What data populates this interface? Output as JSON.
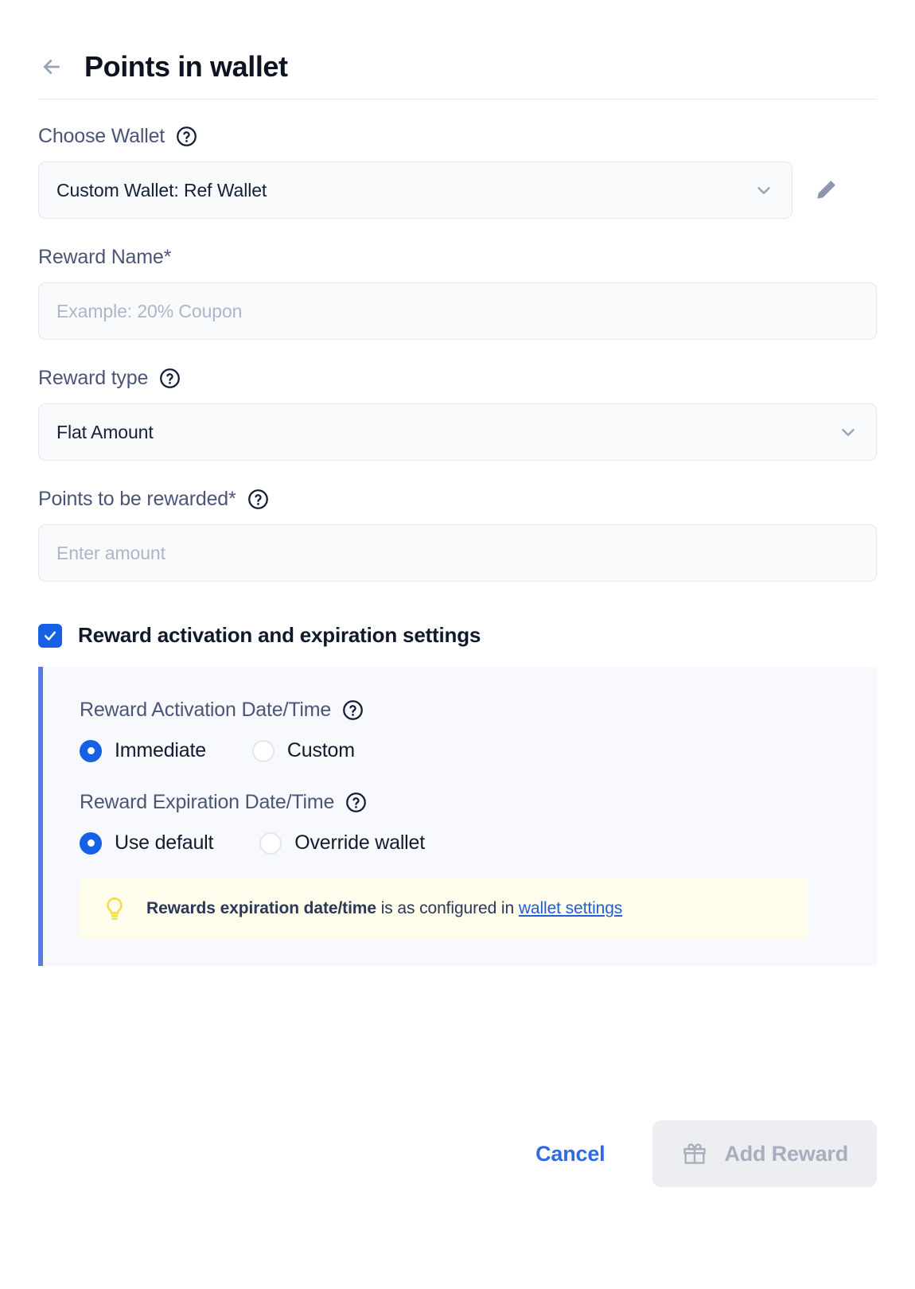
{
  "header": {
    "back_icon": "arrow-left-icon",
    "title": "Points in wallet"
  },
  "form": {
    "wallet": {
      "label": "Choose Wallet",
      "help_icon": "question-mark-icon",
      "selected": "Custom Wallet: Ref Wallet",
      "chevron_icon": "chevron-down-icon",
      "edit_icon": "pencil-icon"
    },
    "reward_name": {
      "label": "Reward Name*",
      "value": "",
      "placeholder": "Example: 20% Coupon"
    },
    "reward_type": {
      "label": "Reward type",
      "help_icon": "question-mark-icon",
      "selected": "Flat Amount",
      "chevron_icon": "chevron-down-icon"
    },
    "points": {
      "label": "Points to be rewarded*",
      "help_icon": "question-mark-icon",
      "value": "",
      "placeholder": "Enter amount"
    },
    "settings_toggle": {
      "label": "Reward activation and expiration settings",
      "checked": true,
      "check_icon": "check-icon"
    },
    "activation": {
      "label": "Reward Activation Date/Time",
      "help_icon": "question-mark-icon",
      "options": [
        {
          "label": "Immediate",
          "selected": true
        },
        {
          "label": "Custom",
          "selected": false
        }
      ]
    },
    "expiration": {
      "label": "Reward Expiration Date/Time",
      "help_icon": "question-mark-icon",
      "options": [
        {
          "label": "Use default",
          "selected": true
        },
        {
          "label": "Override wallet",
          "selected": false
        }
      ]
    },
    "info_banner": {
      "icon": "lightbulb-icon",
      "strong_text": "Rewards expiration date/time",
      "text": " is as configured in ",
      "link_text": "wallet settings"
    }
  },
  "footer": {
    "cancel_label": "Cancel",
    "add_label": "Add Reward",
    "add_icon": "gift-icon",
    "add_disabled": true
  },
  "colors": {
    "accent_blue": "#1560e5",
    "link_blue": "#2d6ae3",
    "panel_bg": "#f7f9fd",
    "panel_border": "#5a7ae8",
    "banner_bg": "#fefcea",
    "bulb_yellow": "#f5d94e",
    "input_bg": "#f8fafc",
    "label_gray": "#4a5578",
    "disabled_gray": "#a7aebc"
  }
}
